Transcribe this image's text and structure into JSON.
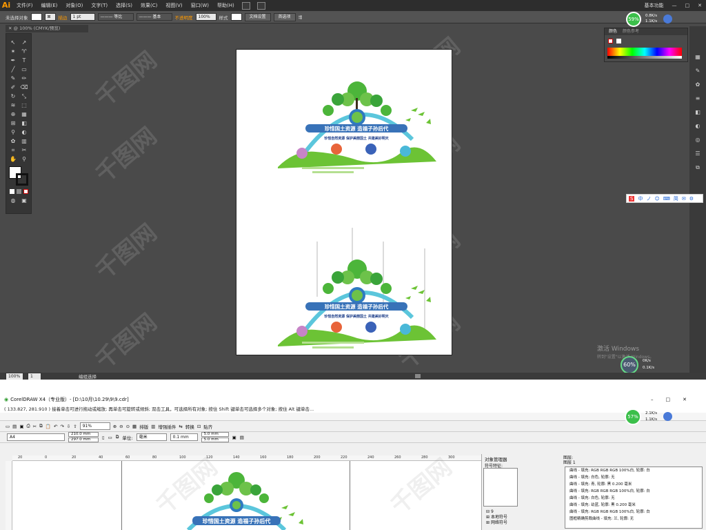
{
  "illustrator": {
    "app_logo": "Ai",
    "menu": [
      "文件(F)",
      "编辑(E)",
      "对象(O)",
      "文字(T)",
      "选择(S)",
      "效果(C)",
      "视图(V)",
      "窗口(W)",
      "帮助(H)"
    ],
    "workspace": "基本功能",
    "control_bar": {
      "selection": "未选择对象",
      "stroke_label": "描边",
      "stroke_value": "1 pt",
      "profile": "等比",
      "brush": "基本",
      "opacity_label": "不透明度",
      "opacity_value": "100%",
      "style_label": "样式",
      "doc_setup": "文档设置",
      "prefs": "首选项"
    },
    "doc_tab": "@ 100% (CMYK/预览)",
    "color_panel": {
      "tab1": "颜色",
      "tab2": "颜色参考"
    },
    "net_widget": {
      "percent": "59%",
      "up": "0.8K/s",
      "down": "1.1K/s"
    },
    "status": {
      "zoom": "100%",
      "page": "1",
      "mode": "编组选择"
    },
    "watermark": "千图网",
    "activate": {
      "line1": "激活 Windows",
      "line2": "转到\"设置\"以激活 Windows。"
    },
    "net_widget2": {
      "percent": "60%",
      "up": "0K/s",
      "down": "0.1K/s"
    },
    "ime_bar": [
      "中",
      "ノ",
      "☺",
      "⌨",
      "简"
    ]
  },
  "artwork": {
    "title": "珍惜国土资源 造福子孙后代",
    "subtitle": "珍惜自然资源  保护美丽国土  共建美好明天",
    "bubbles": [
      "保护耕地",
      "科学规划",
      "保护土地",
      "生态文明"
    ]
  },
  "coreldraw": {
    "title": "CorelDRAW X4（专业版）- [D:\\10月\\10.29\\9\\9.cdr]",
    "hint": "( 133.827, 281.910 )   接着单击可进行拖动或缩放; 再单击可旋转或倾斜; 双击工具，可选择所有对象; 按住 Shift 键单击可选择多个对象; 按住 Alt 键单击...",
    "net_widget": {
      "percent": "57%",
      "up": "2.1K/s",
      "down": "1.1K/s"
    },
    "std_toolbar": {
      "zoom": "91%",
      "layout": "排版",
      "plugins": "增强插件",
      "convert": "转换",
      "paste": "贴齐"
    },
    "prop_bar": {
      "page_size": "A4",
      "width": "210.0 mm",
      "height": "297.0 mm",
      "unit_label": "单位:",
      "unit": "毫米",
      "nudge": "0.1 mm",
      "dup_x": "5.0 mm",
      "dup_y": "5.0 mm"
    },
    "ruler_ticks": [
      "20",
      "0",
      "20",
      "40",
      "60",
      "80",
      "100",
      "120",
      "140",
      "160",
      "180",
      "200",
      "220",
      "240",
      "260",
      "280",
      "300"
    ],
    "obj_mgr": {
      "title": "对象管理器",
      "symbol_label": "符号特征:",
      "layer_label1": "图层:",
      "layer_label2": "图层 1",
      "tree": [
        "9",
        "本地符号",
        "网络符号"
      ],
      "props": [
        "曲线 - 填充: RGB RGB RGB 100%白, 轮廓: 白",
        "曲线 - 填充: 白色, 轮廓: 无",
        "曲线 - 填充: 青, 轮廓: 黑  0.200 毫米",
        "曲线 - 填充: RGB RGB RGB 100%白, 轮廓: 白",
        "曲线 - 填充: 白色, 轮廓: 无",
        "曲线 - 填充: 幼蓝, 轮廓: 黑  0.200 毫米",
        "曲线 - 填充: RGB RGB RGB 100%白, 轮廓: 白",
        "图框精确剪裁曲线 - 填充: 兰, 轮廓: 无"
      ]
    }
  }
}
